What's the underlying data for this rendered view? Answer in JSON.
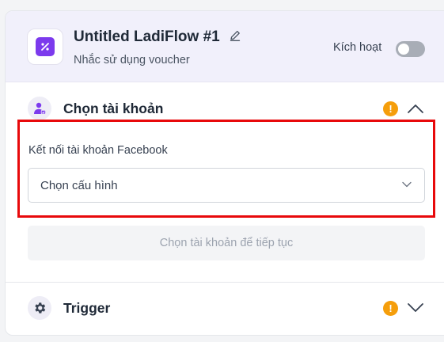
{
  "header": {
    "title": "Untitled LadiFlow #1",
    "subtitle": "Nhắc sử dụng voucher",
    "activate_label": "Kích hoạt",
    "activate_on": false,
    "icon": "percent-tag-icon"
  },
  "account_section": {
    "title": "Chọn tài khoản",
    "warning_symbol": "!",
    "expanded": true,
    "field_label": "Kết nối tài khoản Facebook",
    "select_value": "Chọn cấu hình",
    "continue_label": "Chọn tài khoản để tiếp tục"
  },
  "trigger_section": {
    "title": "Trigger",
    "warning_symbol": "!",
    "expanded": false
  },
  "colors": {
    "accent": "#7c3aed",
    "warning": "#f59e0b",
    "highlight": "#e8090b",
    "header_bg": "#f1f0fb"
  }
}
